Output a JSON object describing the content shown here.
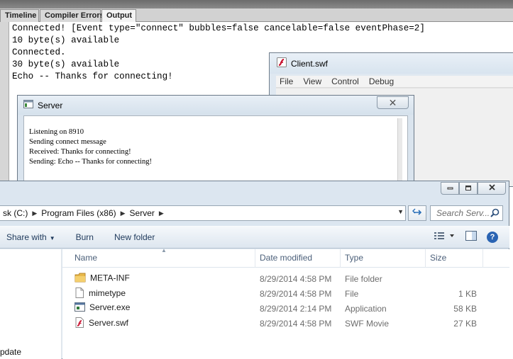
{
  "ide": {
    "tabs": [
      "Timeline",
      "Compiler Errors",
      "Output"
    ],
    "output_lines": [
      "Connected! [Event type=\"connect\" bubbles=false cancelable=false eventPhase=2]",
      "10 byte(s) available",
      "Connected.",
      "30 byte(s) available",
      "Echo -- Thanks for connecting!"
    ]
  },
  "client_window": {
    "title": "Client.swf",
    "menu": [
      "File",
      "View",
      "Control",
      "Debug"
    ]
  },
  "server_window": {
    "title": "Server",
    "close_glyph": "✕",
    "log_lines": [
      "Listening on 8910",
      "Sending connect message",
      "Received: Thanks for connecting!",
      "Sending: Echo -- Thanks for connecting!"
    ]
  },
  "explorer": {
    "breadcrumb": [
      "sk (C:)",
      "Program Files (x86)",
      "Server"
    ],
    "search_placeholder": "Search Serv...",
    "commands": {
      "share": "Share with",
      "burn": "Burn",
      "new_folder": "New folder"
    },
    "columns": {
      "name": "Name",
      "date": "Date modified",
      "type": "Type",
      "size": "Size"
    },
    "files": [
      {
        "name": "META-INF",
        "date": "8/29/2014 4:58 PM",
        "type": "File folder",
        "size": "",
        "icon": "folder-icon"
      },
      {
        "name": "mimetype",
        "date": "8/29/2014 4:58 PM",
        "type": "File",
        "size": "1 KB",
        "icon": "file-icon"
      },
      {
        "name": "Server.exe",
        "date": "8/29/2014 2:14 PM",
        "type": "Application",
        "size": "58 KB",
        "icon": "application-icon"
      },
      {
        "name": "Server.swf",
        "date": "8/29/2014 4:58 PM",
        "type": "SWF Movie",
        "size": "27 KB",
        "icon": "flash-file-icon"
      }
    ],
    "nav_item": "pdate"
  }
}
